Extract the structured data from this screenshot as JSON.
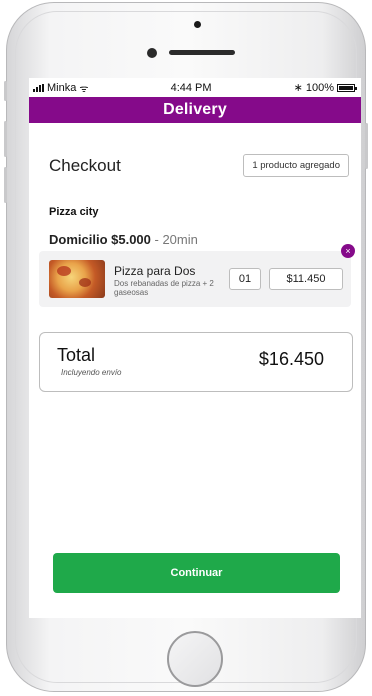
{
  "status_bar": {
    "carrier": "Minka",
    "time": "4:44 PM",
    "battery": "100%"
  },
  "header": {
    "title": "Delivery",
    "color": "#850a8a"
  },
  "checkout": {
    "title": "Checkout",
    "badge": "1 producto agregado"
  },
  "store": {
    "name": "Pizza city",
    "delivery_label": "Domicilio $5.000",
    "delivery_time": " - 20min"
  },
  "item": {
    "name": "Pizza para Dos",
    "description": "Dos rebanadas de pizza + 2 gaseosas",
    "quantity": "01",
    "price": "$11.450",
    "remove_icon": "×"
  },
  "total": {
    "label": "Total",
    "sublabel": "Incluyendo envío",
    "value": "$16.450"
  },
  "footer": {
    "continue_label": "Continuar",
    "button_color": "#1fa94a"
  },
  "icons": {
    "signal": "signal-icon",
    "wifi": "wifi-icon",
    "bluetooth": "bluetooth-icon",
    "battery": "battery-icon",
    "wifi_glyph": "ᯤ",
    "bluetooth_glyph": "∗"
  }
}
